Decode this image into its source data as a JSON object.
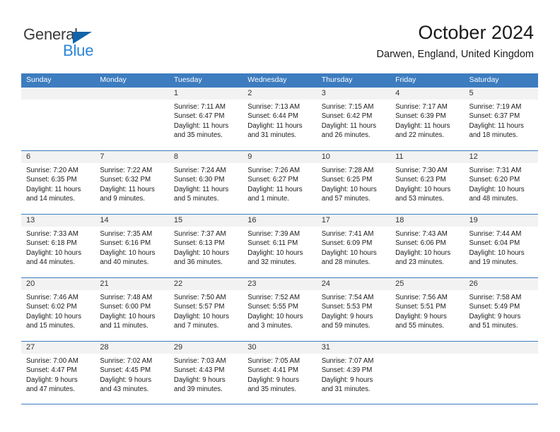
{
  "logo": {
    "word1": "General",
    "word2": "Blue",
    "triangle_color": "#1263a8",
    "word2_color": "#2a86d8"
  },
  "header": {
    "title": "October 2024",
    "subtitle": "Darwen, England, United Kingdom"
  },
  "theme": {
    "header_blue": "#3c7cbf",
    "day_strip_gray": "#f2f2f2"
  },
  "calendar": {
    "weekday_headers": [
      "Sunday",
      "Monday",
      "Tuesday",
      "Wednesday",
      "Thursday",
      "Friday",
      "Saturday"
    ],
    "weeks": [
      [
        {
          "day": "",
          "empty": true,
          "sunrise": "",
          "sunset": "",
          "daylight_1": "",
          "daylight_2": ""
        },
        {
          "day": "",
          "empty": true,
          "sunrise": "",
          "sunset": "",
          "daylight_1": "",
          "daylight_2": ""
        },
        {
          "day": "1",
          "sunrise": "Sunrise: 7:11 AM",
          "sunset": "Sunset: 6:47 PM",
          "daylight_1": "Daylight: 11 hours",
          "daylight_2": "and 35 minutes."
        },
        {
          "day": "2",
          "sunrise": "Sunrise: 7:13 AM",
          "sunset": "Sunset: 6:44 PM",
          "daylight_1": "Daylight: 11 hours",
          "daylight_2": "and 31 minutes."
        },
        {
          "day": "3",
          "sunrise": "Sunrise: 7:15 AM",
          "sunset": "Sunset: 6:42 PM",
          "daylight_1": "Daylight: 11 hours",
          "daylight_2": "and 26 minutes."
        },
        {
          "day": "4",
          "sunrise": "Sunrise: 7:17 AM",
          "sunset": "Sunset: 6:39 PM",
          "daylight_1": "Daylight: 11 hours",
          "daylight_2": "and 22 minutes."
        },
        {
          "day": "5",
          "sunrise": "Sunrise: 7:19 AM",
          "sunset": "Sunset: 6:37 PM",
          "daylight_1": "Daylight: 11 hours",
          "daylight_2": "and 18 minutes."
        }
      ],
      [
        {
          "day": "6",
          "sunrise": "Sunrise: 7:20 AM",
          "sunset": "Sunset: 6:35 PM",
          "daylight_1": "Daylight: 11 hours",
          "daylight_2": "and 14 minutes."
        },
        {
          "day": "7",
          "sunrise": "Sunrise: 7:22 AM",
          "sunset": "Sunset: 6:32 PM",
          "daylight_1": "Daylight: 11 hours",
          "daylight_2": "and 9 minutes."
        },
        {
          "day": "8",
          "sunrise": "Sunrise: 7:24 AM",
          "sunset": "Sunset: 6:30 PM",
          "daylight_1": "Daylight: 11 hours",
          "daylight_2": "and 5 minutes."
        },
        {
          "day": "9",
          "sunrise": "Sunrise: 7:26 AM",
          "sunset": "Sunset: 6:27 PM",
          "daylight_1": "Daylight: 11 hours",
          "daylight_2": "and 1 minute."
        },
        {
          "day": "10",
          "sunrise": "Sunrise: 7:28 AM",
          "sunset": "Sunset: 6:25 PM",
          "daylight_1": "Daylight: 10 hours",
          "daylight_2": "and 57 minutes."
        },
        {
          "day": "11",
          "sunrise": "Sunrise: 7:30 AM",
          "sunset": "Sunset: 6:23 PM",
          "daylight_1": "Daylight: 10 hours",
          "daylight_2": "and 53 minutes."
        },
        {
          "day": "12",
          "sunrise": "Sunrise: 7:31 AM",
          "sunset": "Sunset: 6:20 PM",
          "daylight_1": "Daylight: 10 hours",
          "daylight_2": "and 48 minutes."
        }
      ],
      [
        {
          "day": "13",
          "sunrise": "Sunrise: 7:33 AM",
          "sunset": "Sunset: 6:18 PM",
          "daylight_1": "Daylight: 10 hours",
          "daylight_2": "and 44 minutes."
        },
        {
          "day": "14",
          "sunrise": "Sunrise: 7:35 AM",
          "sunset": "Sunset: 6:16 PM",
          "daylight_1": "Daylight: 10 hours",
          "daylight_2": "and 40 minutes."
        },
        {
          "day": "15",
          "sunrise": "Sunrise: 7:37 AM",
          "sunset": "Sunset: 6:13 PM",
          "daylight_1": "Daylight: 10 hours",
          "daylight_2": "and 36 minutes."
        },
        {
          "day": "16",
          "sunrise": "Sunrise: 7:39 AM",
          "sunset": "Sunset: 6:11 PM",
          "daylight_1": "Daylight: 10 hours",
          "daylight_2": "and 32 minutes."
        },
        {
          "day": "17",
          "sunrise": "Sunrise: 7:41 AM",
          "sunset": "Sunset: 6:09 PM",
          "daylight_1": "Daylight: 10 hours",
          "daylight_2": "and 28 minutes."
        },
        {
          "day": "18",
          "sunrise": "Sunrise: 7:43 AM",
          "sunset": "Sunset: 6:06 PM",
          "daylight_1": "Daylight: 10 hours",
          "daylight_2": "and 23 minutes."
        },
        {
          "day": "19",
          "sunrise": "Sunrise: 7:44 AM",
          "sunset": "Sunset: 6:04 PM",
          "daylight_1": "Daylight: 10 hours",
          "daylight_2": "and 19 minutes."
        }
      ],
      [
        {
          "day": "20",
          "sunrise": "Sunrise: 7:46 AM",
          "sunset": "Sunset: 6:02 PM",
          "daylight_1": "Daylight: 10 hours",
          "daylight_2": "and 15 minutes."
        },
        {
          "day": "21",
          "sunrise": "Sunrise: 7:48 AM",
          "sunset": "Sunset: 6:00 PM",
          "daylight_1": "Daylight: 10 hours",
          "daylight_2": "and 11 minutes."
        },
        {
          "day": "22",
          "sunrise": "Sunrise: 7:50 AM",
          "sunset": "Sunset: 5:57 PM",
          "daylight_1": "Daylight: 10 hours",
          "daylight_2": "and 7 minutes."
        },
        {
          "day": "23",
          "sunrise": "Sunrise: 7:52 AM",
          "sunset": "Sunset: 5:55 PM",
          "daylight_1": "Daylight: 10 hours",
          "daylight_2": "and 3 minutes."
        },
        {
          "day": "24",
          "sunrise": "Sunrise: 7:54 AM",
          "sunset": "Sunset: 5:53 PM",
          "daylight_1": "Daylight: 9 hours",
          "daylight_2": "and 59 minutes."
        },
        {
          "day": "25",
          "sunrise": "Sunrise: 7:56 AM",
          "sunset": "Sunset: 5:51 PM",
          "daylight_1": "Daylight: 9 hours",
          "daylight_2": "and 55 minutes."
        },
        {
          "day": "26",
          "sunrise": "Sunrise: 7:58 AM",
          "sunset": "Sunset: 5:49 PM",
          "daylight_1": "Daylight: 9 hours",
          "daylight_2": "and 51 minutes."
        }
      ],
      [
        {
          "day": "27",
          "sunrise": "Sunrise: 7:00 AM",
          "sunset": "Sunset: 4:47 PM",
          "daylight_1": "Daylight: 9 hours",
          "daylight_2": "and 47 minutes."
        },
        {
          "day": "28",
          "sunrise": "Sunrise: 7:02 AM",
          "sunset": "Sunset: 4:45 PM",
          "daylight_1": "Daylight: 9 hours",
          "daylight_2": "and 43 minutes."
        },
        {
          "day": "29",
          "sunrise": "Sunrise: 7:03 AM",
          "sunset": "Sunset: 4:43 PM",
          "daylight_1": "Daylight: 9 hours",
          "daylight_2": "and 39 minutes."
        },
        {
          "day": "30",
          "sunrise": "Sunrise: 7:05 AM",
          "sunset": "Sunset: 4:41 PM",
          "daylight_1": "Daylight: 9 hours",
          "daylight_2": "and 35 minutes."
        },
        {
          "day": "31",
          "sunrise": "Sunrise: 7:07 AM",
          "sunset": "Sunset: 4:39 PM",
          "daylight_1": "Daylight: 9 hours",
          "daylight_2": "and 31 minutes."
        },
        {
          "day": "",
          "empty": true,
          "sunrise": "",
          "sunset": "",
          "daylight_1": "",
          "daylight_2": ""
        },
        {
          "day": "",
          "empty": true,
          "sunrise": "",
          "sunset": "",
          "daylight_1": "",
          "daylight_2": ""
        }
      ]
    ]
  }
}
